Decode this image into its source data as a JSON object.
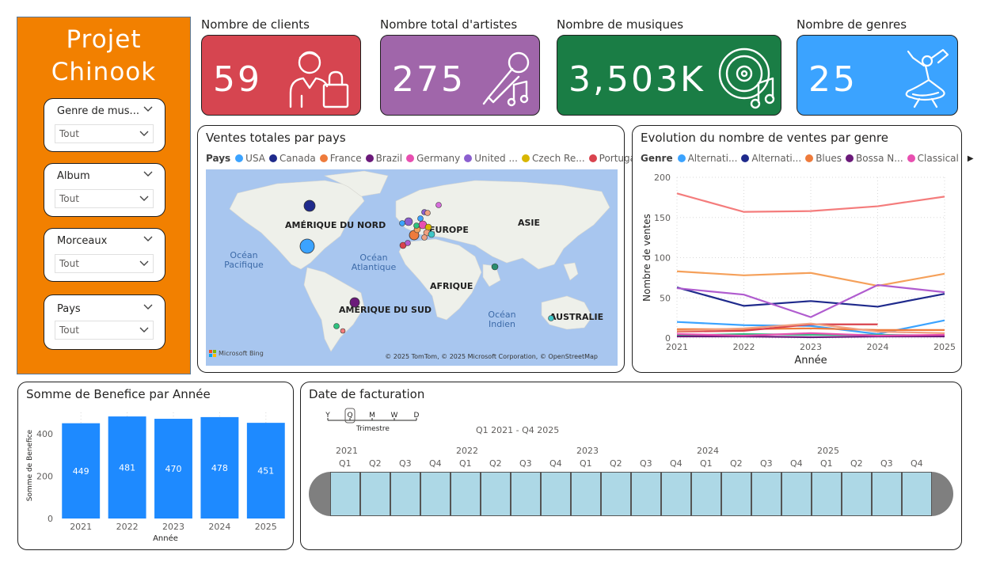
{
  "sidebar": {
    "title_line1": "Projet",
    "title_line2": "Chinook",
    "bg_color": "#f28000",
    "slicers": [
      {
        "label": "Genre de mus...",
        "value": "Tout"
      },
      {
        "label": "Album",
        "value": "Tout"
      },
      {
        "label": "Morceaux",
        "value": "Tout"
      },
      {
        "label": "Pays",
        "value": "Tout"
      }
    ]
  },
  "kpis": [
    {
      "label": "Nombre de clients",
      "value": "59",
      "color": "#d64550",
      "icon": "customer-shopping-bag-icon"
    },
    {
      "label": "Nombre total d'artistes",
      "value": "275",
      "color": "#a066aa",
      "icon": "microphone-music-icon"
    },
    {
      "label": "Nombre de musiques",
      "value": "3,503K",
      "color": "#1a7d45",
      "icon": "vinyl-music-icon"
    },
    {
      "label": "Nombre de genres",
      "value": "25",
      "color": "#3ba3ff",
      "icon": "dancer-icon"
    }
  ],
  "map_panel": {
    "title": "Ventes totales par pays",
    "legend_title": "Pays",
    "legend": [
      {
        "name": "USA",
        "color": "#3ba3ff"
      },
      {
        "name": "Canada",
        "color": "#1f2a8c"
      },
      {
        "name": "France",
        "color": "#ee7b3c"
      },
      {
        "name": "Brazil",
        "color": "#6b1a7a"
      },
      {
        "name": "Germany",
        "color": "#e84fb0"
      },
      {
        "name": "United ...",
        "color": "#8b5fcf"
      },
      {
        "name": "Czech Re...",
        "color": "#d8b600"
      },
      {
        "name": "Portugal",
        "color": "#d9434e"
      }
    ],
    "continents": [
      "AMÉRIQUE DU NORD",
      "EUROPE",
      "ASIE",
      "AFRIQUE",
      "AMÉRIQUE DU SUD",
      "AUSTRALIE"
    ],
    "oceans": [
      "Océan Pacifique",
      "Océan Atlantique",
      "Océan Indien"
    ],
    "bing_label": "Microsoft Bing",
    "copyright": "© 2025 TomTom, © 2025 Microsoft Corporation, © OpenStreetMap"
  },
  "line_panel": {
    "title": "Evolution du nombre de ventes par genre",
    "legend_title": "Genre",
    "legend": [
      {
        "name": "Alternati...",
        "color": "#3ba3ff"
      },
      {
        "name": "Alternati...",
        "color": "#1f2a8c"
      },
      {
        "name": "Blues",
        "color": "#ee7b3c"
      },
      {
        "name": "Bossa N...",
        "color": "#6b1a7a"
      },
      {
        "name": "Classical",
        "color": "#e84fb0"
      }
    ]
  },
  "bar_panel": {
    "title": "Somme de Benefice par Année"
  },
  "timeline_panel": {
    "title": "Date de facturation",
    "granularity": [
      "Y",
      "Q",
      "M",
      "W",
      "D"
    ],
    "selected_granularity": "Trimestre",
    "range_label": "Q1 2021 - Q4 2025",
    "years": [
      "2021",
      "2022",
      "2023",
      "2024",
      "2025"
    ],
    "quarters": [
      "Q1",
      "Q2",
      "Q3",
      "Q4"
    ]
  },
  "chart_data": [
    {
      "type": "line",
      "title": "Evolution du nombre de ventes par genre",
      "xlabel": "Année",
      "ylabel": "Nombre de ventes",
      "x": [
        2021,
        2022,
        2023,
        2024,
        2025
      ],
      "ylim": [
        0,
        200
      ],
      "yticks": [
        0,
        50,
        100,
        150,
        200
      ],
      "grid": true,
      "series": [
        {
          "color": "#f47c7c",
          "values": [
            180,
            157,
            158,
            164,
            176
          ]
        },
        {
          "color": "#f5a05a",
          "values": [
            83,
            78,
            81,
            65,
            80
          ]
        },
        {
          "color": "#1f2a8c",
          "values": [
            63,
            40,
            46,
            39,
            55
          ]
        },
        {
          "color": "#b05ccf",
          "values": [
            62,
            54,
            26,
            66,
            57
          ]
        },
        {
          "color": "#3ba3ff",
          "values": [
            20,
            16,
            15,
            5,
            22
          ]
        },
        {
          "color": "#ee7b3c",
          "values": [
            11,
            11,
            12,
            10,
            10
          ]
        },
        {
          "color": "#d9434e",
          "values": [
            8,
            9,
            17,
            17,
            null
          ]
        },
        {
          "color": "#f0a080",
          "values": [
            9,
            12,
            18,
            8,
            6
          ]
        },
        {
          "color": "#2ec27e",
          "values": [
            3,
            5,
            4,
            4,
            3
          ]
        },
        {
          "color": "#6b1a7a",
          "values": [
            2,
            2,
            1,
            2,
            2
          ]
        },
        {
          "color": "#e84fb0",
          "values": [
            5,
            3,
            6,
            3,
            4
          ]
        }
      ]
    },
    {
      "type": "bar",
      "title": "Somme de Benefice par Année",
      "xlabel": "Année",
      "ylabel": "Somme de Benefice",
      "categories": [
        "2021",
        "2022",
        "2023",
        "2024",
        "2025"
      ],
      "values": [
        449,
        481,
        470,
        478,
        451
      ],
      "ylim": [
        0,
        500
      ],
      "yticks": [
        0,
        200,
        400
      ],
      "color": "#1e8aff",
      "grid": true
    }
  ]
}
